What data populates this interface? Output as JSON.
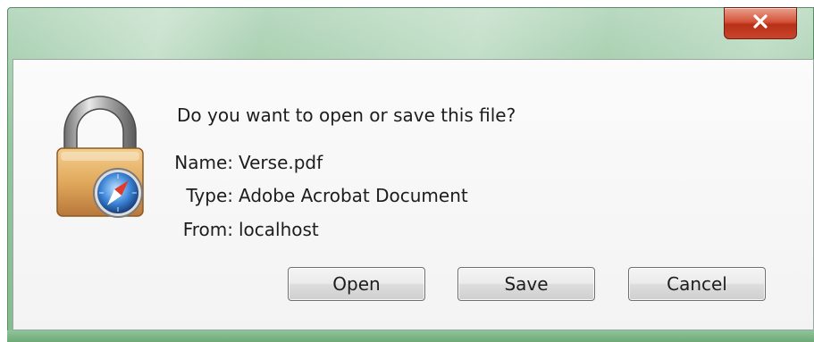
{
  "dialog": {
    "question": "Do you want to open or save this file?",
    "fields": {
      "name": {
        "label": "Name:",
        "value": "Verse.pdf"
      },
      "type": {
        "label": "Type:",
        "value": "Adobe Acrobat Document"
      },
      "from": {
        "label": "From:",
        "value": "localhost"
      }
    },
    "buttons": {
      "open": "Open",
      "save": "Save",
      "cancel": "Cancel"
    },
    "close_glyph": "x"
  },
  "icons": {
    "close": "close-icon",
    "lock": "padlock-safari-icon"
  },
  "colors": {
    "frame_green": "#8fc49a",
    "close_red": "#c7452b",
    "text": "#1d1d1d"
  }
}
